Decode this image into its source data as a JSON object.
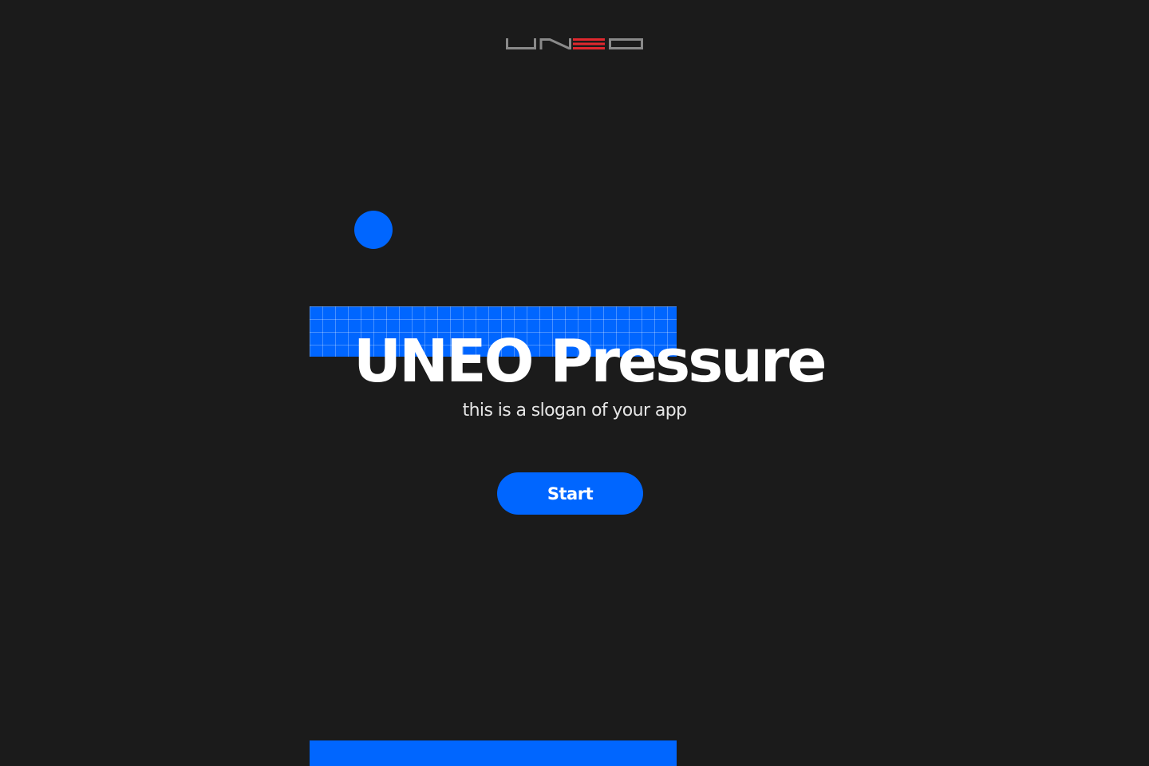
{
  "colors": {
    "background": "#1b1b1b",
    "accent": "#0066ff",
    "logo_gray": "#8a8a8a",
    "logo_red": "#e0282e"
  },
  "header": {
    "logo_icon": "uneo-wordmark-logo"
  },
  "hero": {
    "title": "UNEO Pressure",
    "slogan": "this is a slogan of your app",
    "start_label": "Start"
  },
  "decorations": {
    "dot_icon": "blue-circle",
    "grid_icon": "blue-grid-block"
  }
}
